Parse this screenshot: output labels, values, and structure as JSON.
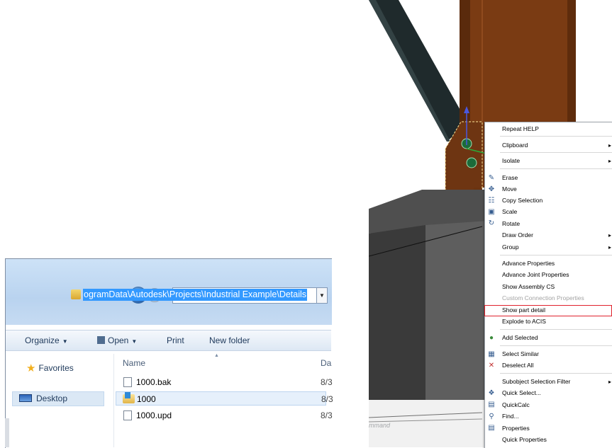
{
  "explorer": {
    "address_path": "ogramData\\Autodesk\\Projects\\Industrial Example\\Details",
    "toolbar": {
      "organize": "Organize",
      "open": "Open",
      "print": "Print",
      "new_folder": "New folder"
    },
    "nav": {
      "favorites": "Favorites",
      "desktop": "Desktop"
    },
    "columns": {
      "name": "Name",
      "date": "Da"
    },
    "files": [
      {
        "name": "1000.bak",
        "date": "8/3",
        "type": "file"
      },
      {
        "name": "1000",
        "date": "8/3",
        "type": "folder"
      },
      {
        "name": "1000.upd",
        "date": "8/3",
        "type": "file"
      }
    ]
  },
  "cad": {
    "command_label": "mmand"
  },
  "context_menu": {
    "items": [
      {
        "label": "Repeat HELP",
        "submenu": false
      },
      {
        "label": "Clipboard",
        "submenu": true
      },
      {
        "label": "Isolate",
        "submenu": true
      },
      {
        "label": "Erase",
        "icon": "eraser-icon"
      },
      {
        "label": "Move",
        "icon": "move-icon"
      },
      {
        "label": "Copy Selection",
        "icon": "copy-icon"
      },
      {
        "label": "Scale",
        "icon": "scale-icon"
      },
      {
        "label": "Rotate",
        "icon": "rotate-icon"
      },
      {
        "label": "Draw Order",
        "submenu": true
      },
      {
        "label": "Group",
        "submenu": true
      },
      {
        "label": "Advance Properties"
      },
      {
        "label": "Advance Joint Properties"
      },
      {
        "label": "Show Assembly CS"
      },
      {
        "label": "Custom Connection Properties",
        "disabled": true
      },
      {
        "label": "Show part detail",
        "highlighted": true
      },
      {
        "label": "Explode to ACIS"
      },
      {
        "label": "Add Selected",
        "icon": "add-selected-icon"
      },
      {
        "label": "Select Similar",
        "icon": "select-similar-icon"
      },
      {
        "label": "Deselect All",
        "icon": "deselect-icon"
      },
      {
        "label": "Subobject Selection Filter",
        "submenu": true
      },
      {
        "label": "Quick Select...",
        "icon": "quick-select-icon"
      },
      {
        "label": "QuickCalc",
        "icon": "calculator-icon"
      },
      {
        "label": "Find...",
        "icon": "find-icon"
      },
      {
        "label": "Properties",
        "icon": "properties-icon"
      },
      {
        "label": "Quick Properties"
      }
    ]
  }
}
